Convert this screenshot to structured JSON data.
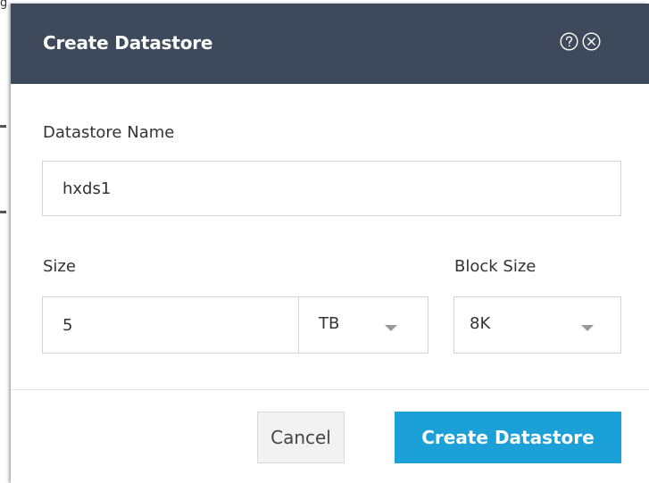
{
  "dialog": {
    "title": "Create Datastore",
    "help_icon": "help-circle-icon",
    "close_icon": "close-circle-icon",
    "header_color": "#3e4a5c"
  },
  "form": {
    "name_label": "Datastore Name",
    "name_value": "hxds1",
    "size_label": "Size",
    "size_value": "5",
    "size_unit": "TB",
    "block_size_label": "Block Size",
    "block_size_value": "8K"
  },
  "buttons": {
    "cancel_label": "Cancel",
    "create_label": "Create Datastore",
    "primary_color": "#1ba0d8"
  }
}
